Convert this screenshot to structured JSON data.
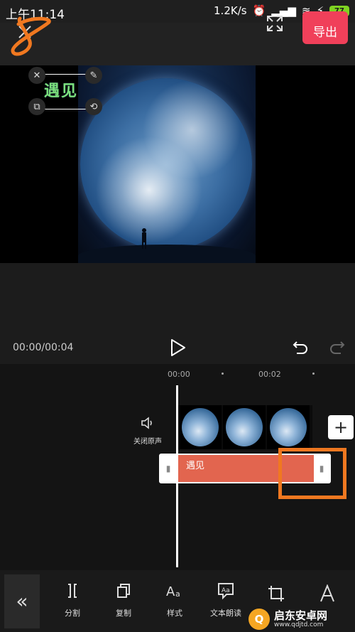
{
  "status_bar": {
    "time": "上午11:14",
    "net_speed": "1.2K/s",
    "battery": "77"
  },
  "header": {
    "export_label": "导出"
  },
  "preview": {
    "sticker_text": "遇见"
  },
  "player": {
    "time": "00:00/00:04"
  },
  "timeline": {
    "ruler": [
      "00:00",
      "00:02"
    ],
    "mute_label": "关闭原声",
    "add_label": "+",
    "text_track_label": "遇见"
  },
  "toolbar": {
    "collapse_label": "«",
    "items": [
      {
        "label": "分割",
        "icon": "split-icon"
      },
      {
        "label": "复制",
        "icon": "copy-icon"
      },
      {
        "label": "样式",
        "icon": "text-style-icon"
      },
      {
        "label": "文本朗读",
        "icon": "text-to-speech-icon"
      }
    ]
  },
  "watermark": {
    "title": "启东安卓网",
    "url": "www.qdjtd.com"
  },
  "colors": {
    "accent": "#f0405a",
    "text_track": "#e2654f",
    "highlight": "#f07820"
  }
}
